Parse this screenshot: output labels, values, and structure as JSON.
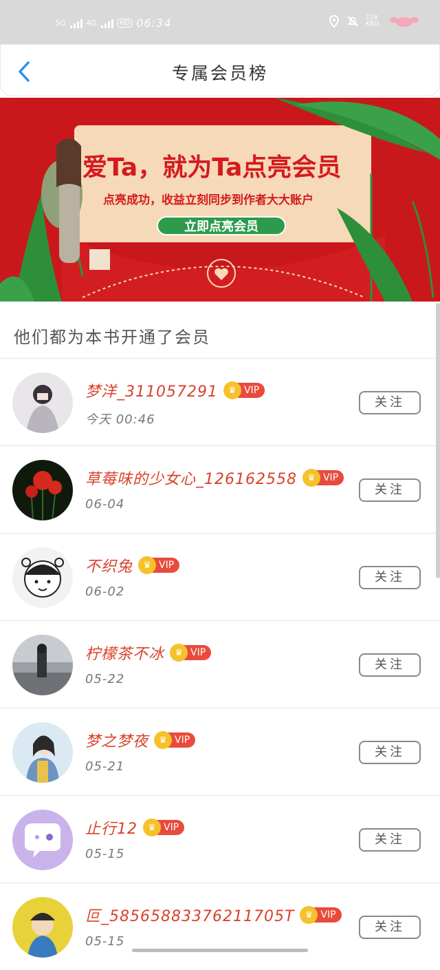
{
  "status_bar": {
    "network_1": "5G",
    "network_2": "4G",
    "hd": "HD",
    "time": "06:34",
    "speed": "118 KB/s"
  },
  "nav": {
    "title": "专属会员榜"
  },
  "banner": {
    "headline": "爱Ta，就为Ta点亮会员",
    "subtitle": "点亮成功，收益立刻同步到作者大大账户",
    "button_label": "立即点亮会员"
  },
  "section": {
    "title": "他们都为本书开通了会员"
  },
  "members": [
    {
      "name": "梦洋_311057291",
      "date": "今天 00:46",
      "vip": "VIP",
      "follow": "关注"
    },
    {
      "name": "草莓味的少女心_126162558",
      "date": "06-04",
      "vip": "VIP",
      "follow": "关注"
    },
    {
      "name": "不织兔",
      "date": "06-02",
      "vip": "VIP",
      "follow": "关注"
    },
    {
      "name": "柠檬茶不冰",
      "date": "05-22",
      "vip": "VIP",
      "follow": "关注"
    },
    {
      "name": "梦之梦夜",
      "date": "05-21",
      "vip": "VIP",
      "follow": "关注"
    },
    {
      "name": "止行12",
      "date": "05-15",
      "vip": "VIP",
      "follow": "关注"
    },
    {
      "name": "叵_58565883376211705T",
      "date": "05-15",
      "vip": "VIP",
      "follow": "关注"
    }
  ],
  "colors": {
    "accent_blue": "#2d8ef0",
    "name_red": "#d9412a",
    "vip_red": "#e84b3c",
    "banner_red": "#c9181b"
  }
}
